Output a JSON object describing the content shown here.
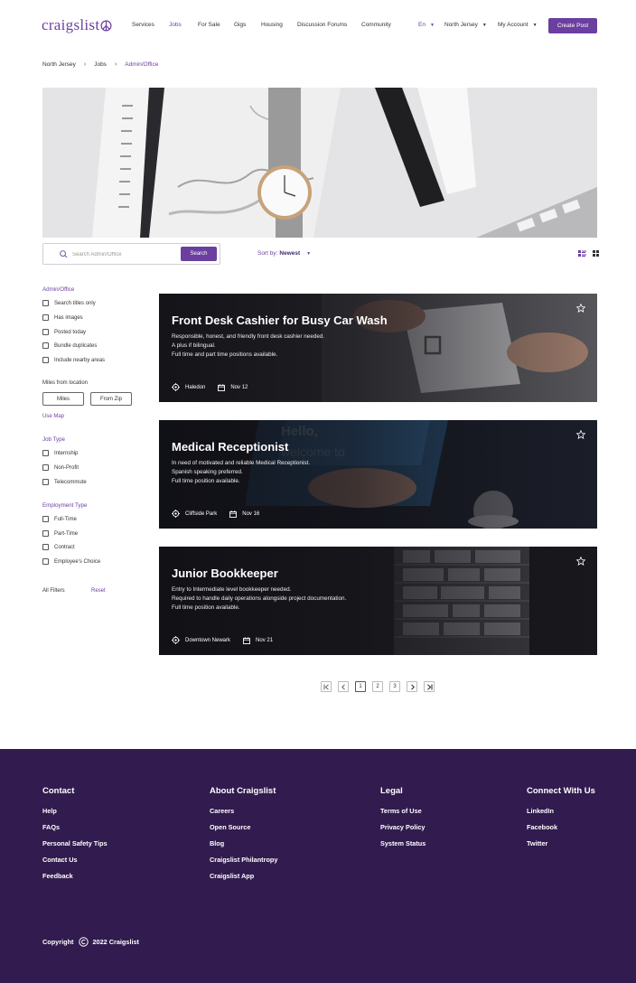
{
  "header": {
    "logo_text": "craigslist",
    "nav": [
      "Services",
      "Jobs",
      "For Sale",
      "Gigs",
      "Housing",
      "Discussion Forums",
      "Community"
    ],
    "active_nav": "Jobs",
    "language": "En",
    "location": "North Jersey",
    "account": "My Account",
    "create_post": "Create Post"
  },
  "breadcrumb": [
    "North Jersey",
    "Jobs",
    "Admin/Office"
  ],
  "search": {
    "placeholder": "Search Admin/Office",
    "button": "Search",
    "sort_label": "Sort by:",
    "sort_value": "Newest"
  },
  "sidebar": {
    "category": "Admin/Office",
    "options": [
      "Search titles only",
      "Has images",
      "Posted today",
      "Bundle duplicates",
      "Include nearby areas"
    ],
    "miles_label": "Miles from location",
    "miles_placeholder": "Miles",
    "zip_placeholder": "From Zip",
    "use_map": "Use Map",
    "job_type_title": "Job Type",
    "job_types": [
      "Internship",
      "Non-Profit",
      "Telecommute"
    ],
    "employment_title": "Employment Type",
    "employment_types": [
      "Full-Time",
      "Part-Time",
      "Contract",
      "Employee's Choice"
    ],
    "all_filters": "All Filters",
    "reset": "Reset"
  },
  "listings": [
    {
      "title": "Front Desk Cashier for Busy Car Wash",
      "lines": [
        "Responsible, honest, and friendly front desk cashier needed.",
        "A plus if bilingual.",
        "Full time and part time positions available."
      ],
      "location": "Haledon",
      "date": "Nov 12"
    },
    {
      "title": "Medical Receptionist",
      "lines": [
        "In need of motivated and reliable Medical Receptionist.",
        "Spanish speaking preferred.",
        "Full time position available."
      ],
      "location": "Cliffside Park",
      "date": "Nov 16"
    },
    {
      "title": "Junior Bookkeeper",
      "lines": [
        "Entry to Intermediate level bookkeeper needed.",
        "Required to handle daily operations alongside project documentation.",
        "Full time position available."
      ],
      "location": "Downtown Newark",
      "date": "Nov 21"
    }
  ],
  "pagination": {
    "pages": [
      "1",
      "2",
      "3"
    ],
    "current": "1"
  },
  "footer": {
    "contact": {
      "title": "Contact",
      "links": [
        "Help",
        "FAQs",
        "Personal Safety Tips",
        "Contact Us",
        "Feedback"
      ]
    },
    "about": {
      "title": "About Craigslist",
      "links": [
        "Careers",
        "Open Source",
        "Blog",
        "Craigslist Philantropy",
        "Craigslist App"
      ]
    },
    "legal": {
      "title": "Legal",
      "links": [
        "Terms of Use",
        "Privacy Policy",
        "System Status"
      ]
    },
    "connect": {
      "title": "Connect With Us",
      "links": [
        "LinkedIn",
        "Facebook",
        "Twitter"
      ]
    },
    "copyright_prefix": "Copyright",
    "copyright_text": "2022 Craigslist"
  },
  "colors": {
    "brand": "#6b3fa0",
    "footer_bg": "#321b4f"
  }
}
